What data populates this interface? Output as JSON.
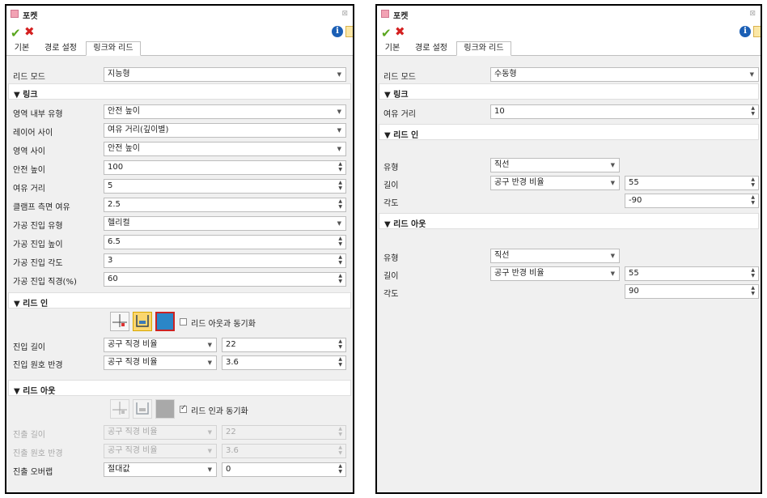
{
  "left": {
    "title": "포켓",
    "tabs": [
      "기본",
      "경로 설정",
      "링크와 리드"
    ],
    "lead_mode": {
      "label": "리드 모드",
      "value": "지능형"
    },
    "link_section": "▼ 링크",
    "link_rows": [
      {
        "label": "영역 내부 유형",
        "value": "안전 높이",
        "kind": "dropdown"
      },
      {
        "label": "레이어 사이",
        "value": "여유 거리(깊이별)",
        "kind": "dropdown"
      },
      {
        "label": "영역 사이",
        "value": "안전 높이",
        "kind": "dropdown"
      },
      {
        "label": "안전 높이",
        "value": "100",
        "kind": "spin"
      },
      {
        "label": "여유 거리",
        "value": "5",
        "kind": "spin"
      },
      {
        "label": "클램프 측면 여유",
        "value": "2.5",
        "kind": "spin"
      },
      {
        "label": "가공 진입 유형",
        "value": "헬리컬",
        "kind": "dropdown"
      },
      {
        "label": "가공 진입 높이",
        "value": "6.5",
        "kind": "spin"
      },
      {
        "label": "가공 진입 각도",
        "value": "3",
        "kind": "spin"
      },
      {
        "label": "가공 진입 직경(%)",
        "value": "60",
        "kind": "spin"
      }
    ],
    "lead_in_section": "▼ 리드 인",
    "lead_in_sync": "리드 아웃과 동기화",
    "lead_in_rows": [
      {
        "label": "진입 길이",
        "type": "공구 직경 비율",
        "value": "22"
      },
      {
        "label": "진입 원호 반경",
        "type": "공구 직경 비율",
        "value": "3.6"
      }
    ],
    "lead_out_section": "▼ 리드 아웃",
    "lead_out_sync": "리드 인과 동기화",
    "lead_out_rows": [
      {
        "label": "진출 길이",
        "type": "공구 직경 비율",
        "value": "22"
      },
      {
        "label": "진출 원호 반경",
        "type": "공구 직경 비율",
        "value": "3.6"
      },
      {
        "label": "진출 오버랩",
        "type": "절대값",
        "value": "0"
      }
    ]
  },
  "right": {
    "title": "포켓",
    "tabs": [
      "기본",
      "경로 설정",
      "링크와 리드"
    ],
    "lead_mode": {
      "label": "리드 모드",
      "value": "수동형"
    },
    "link_section": "▼ 링크",
    "clearance": {
      "label": "여유 거리",
      "value": "10"
    },
    "lead_in_section": "▼ 리드 인",
    "lead_in": {
      "type_label": "유형",
      "type_value": "직선",
      "length_label": "길이",
      "length_type": "공구 반경 비율",
      "length_value": "55",
      "angle_label": "각도",
      "angle_value": "-90"
    },
    "lead_out_section": "▼ 리드 아웃",
    "lead_out": {
      "type_label": "유형",
      "type_value": "직선",
      "length_label": "길이",
      "length_type": "공구 반경 비율",
      "length_value": "55",
      "angle_label": "각도",
      "angle_value": "90"
    }
  },
  "icons": {
    "ok": "✔",
    "cancel": "✖",
    "info": "i",
    "restore": "⊠",
    "dropdown": "▼",
    "spin": "▲▼"
  }
}
